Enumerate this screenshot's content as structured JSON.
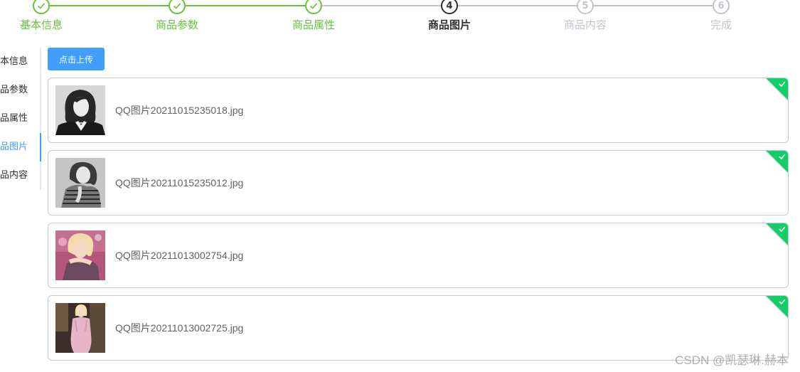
{
  "colors": {
    "primary": "#409eff",
    "success": "#67c23a",
    "process": "#303133",
    "wait": "#c0c4cc",
    "upload_success_badge": "#13ce66"
  },
  "steps": [
    {
      "number": "1",
      "title": "基本信息",
      "status": "success",
      "icon": "check-icon"
    },
    {
      "number": "2",
      "title": "商品参数",
      "status": "success",
      "icon": "check-icon"
    },
    {
      "number": "3",
      "title": "商品属性",
      "status": "success",
      "icon": "check-icon"
    },
    {
      "number": "4",
      "title": "商品图片",
      "status": "process"
    },
    {
      "number": "5",
      "title": "商品内容",
      "status": "wait"
    },
    {
      "number": "6",
      "title": "完成",
      "status": "wait"
    }
  ],
  "tabs": {
    "active_index": 3,
    "items": [
      {
        "label": "本信息"
      },
      {
        "label": "品参数"
      },
      {
        "label": "品属性"
      },
      {
        "label": "品图片"
      },
      {
        "label": "品内容"
      }
    ]
  },
  "upload": {
    "button_label": "点击上传",
    "files": [
      {
        "name": "QQ图片20211015235018.jpg",
        "status": "success",
        "thumbnail": "woman-portrait-bw"
      },
      {
        "name": "QQ图片20211015235012.jpg",
        "status": "success",
        "thumbnail": "woman-portrait-striped-bw"
      },
      {
        "name": "QQ图片20211013002754.jpg",
        "status": "success",
        "thumbnail": "woman-blonde-color"
      },
      {
        "name": "QQ图片20211013002725.jpg",
        "status": "success",
        "thumbnail": "woman-pink-dress-color"
      }
    ]
  },
  "watermark": "CSDN @凯瑟琳.赫本"
}
